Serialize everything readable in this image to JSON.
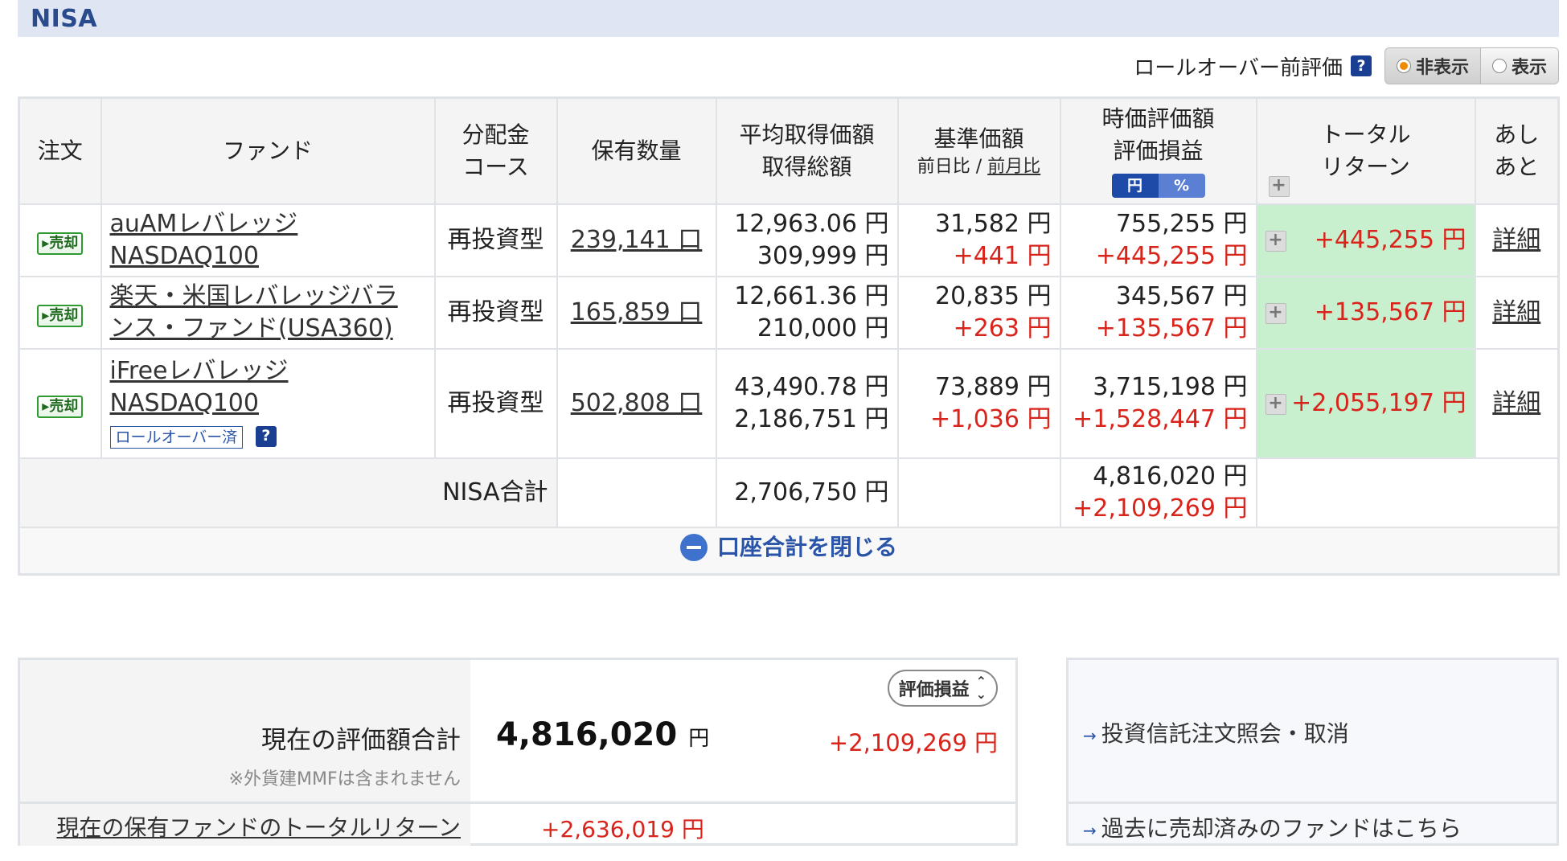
{
  "section": {
    "title": "NISA"
  },
  "rollover": {
    "label": "ロールオーバー前評価",
    "help": "?",
    "hide": "非表示",
    "show": "表示"
  },
  "headers": {
    "order": "注文",
    "fund": "ファンド",
    "dist_1": "分配金",
    "dist_2": "コース",
    "qty": "保有数量",
    "avg_1": "平均取得価額",
    "avg_2": "取得総額",
    "base_1": "基準価額",
    "base_sub_a": "前日比 / ",
    "base_sub_b": "前月比",
    "mv_1": "時価評価額",
    "mv_2": "評価損益",
    "mv_toggle_yen": "円",
    "mv_toggle_pct": "%",
    "tr_1": "トータル",
    "tr_2": "リターン",
    "ashi_1": "あし",
    "ashi_2": "あと"
  },
  "common": {
    "sell": "▸売却",
    "plus": "+",
    "detail": "詳細"
  },
  "funds": [
    {
      "name_1": "auAMレバレッジ",
      "name_2": "NASDAQ100",
      "course": "再投資型",
      "qty": "239,141 口",
      "avg_price": "12,963.06 円",
      "cost": "309,999 円",
      "base_price": "31,582 円",
      "base_change": "+441 円",
      "market_value": "755,255 円",
      "pl": "+445,255 円",
      "total_return": "+445,255 円"
    },
    {
      "name_1": "楽天・米国レバレッジバラ",
      "name_2": "ンス・ファンド(USA360)",
      "course": "再投資型",
      "qty": "165,859 口",
      "avg_price": "12,661.36 円",
      "cost": "210,000 円",
      "base_price": "20,835 円",
      "base_change": "+263 円",
      "market_value": "345,567 円",
      "pl": "+135,567 円",
      "total_return": "+135,567 円"
    },
    {
      "name_1": "iFreeレバレッジ",
      "name_2": "NASDAQ100",
      "badge": "ロールオーバー済",
      "course": "再投資型",
      "qty": "502,808 口",
      "avg_price": "43,490.78 円",
      "cost": "2,186,751 円",
      "base_price": "73,889 円",
      "base_change": "+1,036 円",
      "market_value": "3,715,198 円",
      "pl": "+1,528,447 円",
      "total_return": "+2,055,197 円"
    }
  ],
  "nisa_total": {
    "label": "NISA合計",
    "cost": "2,706,750 円",
    "market_value": "4,816,020 円",
    "pl": "+2,109,269 円"
  },
  "close_button": "口座合計を閉じる",
  "summary": {
    "select_label": "評価損益",
    "label": "現在の評価額合計",
    "value": "4,816,020",
    "yen": "円",
    "pl": "+2,109,269 円",
    "note": "※外貨建MMFは含まれません",
    "total_return_label": "現在の保有ファンドのトータルリターン",
    "total_return_value": "+2,636,019 円"
  },
  "links": {
    "order_inquiry": "投資信託注文照会・取消",
    "sold_funds": "過去に売却済みのファンドはこちら"
  }
}
